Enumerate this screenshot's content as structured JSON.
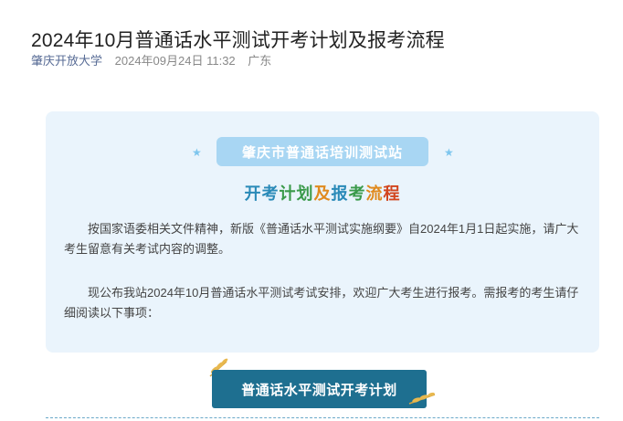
{
  "article": {
    "title": "2024年10月普通话水平测试开考计划及报考流程",
    "source": "肇庆开放大学",
    "datetime": "2024年09月24日 11:32",
    "location": "广东"
  },
  "card": {
    "banner": "肇庆市普通话培训测试站",
    "subtitle_parts": [
      {
        "text": "开",
        "color": "#2a8ab8"
      },
      {
        "text": "考",
        "color": "#2a8ab8"
      },
      {
        "text": "计",
        "color": "#3a9a4a"
      },
      {
        "text": "划",
        "color": "#3a9a4a"
      },
      {
        "text": "及",
        "color": "#e08a1e"
      },
      {
        "text": "报",
        "color": "#2a8ab8"
      },
      {
        "text": "考",
        "color": "#3a9a4a"
      },
      {
        "text": "流",
        "color": "#e08a1e"
      },
      {
        "text": "程",
        "color": "#d2451e"
      }
    ],
    "paragraph1": "按国家语委相关文件精神，新版《普通话水平测试实施纲要》自2024年1月1日起实施，请广大考生留意有关考试内容的调整。",
    "paragraph2": "现公布我站2024年10月普通话水平测试考试安排，欢迎广大考生进行报考。需报考的考生请仔细阅读以下事项："
  },
  "section_button": "普通话水平测试开考计划"
}
